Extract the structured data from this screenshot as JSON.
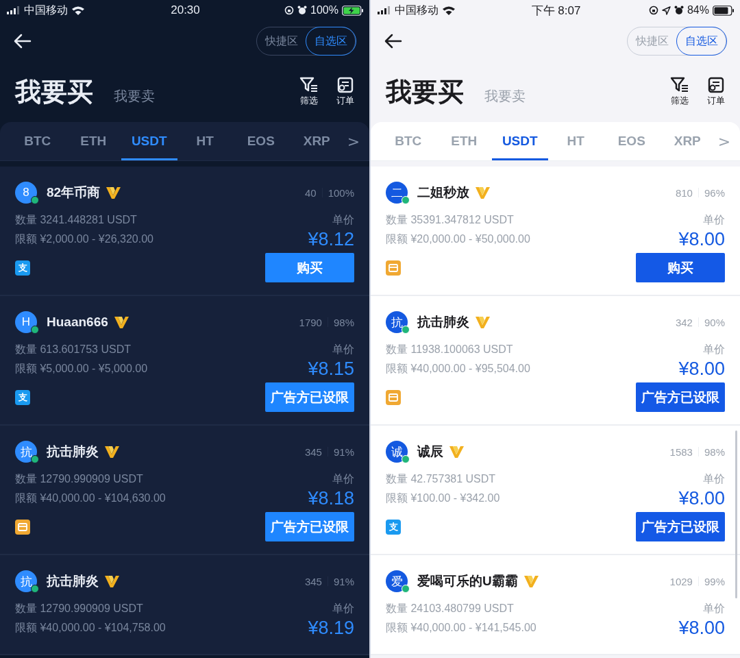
{
  "screens": [
    {
      "kind": "dark",
      "status_bar": {
        "carrier": "中国移动",
        "time": "20:30",
        "battery": "100%",
        "charging": true,
        "location": false
      },
      "segments": [
        {
          "label": "快捷区",
          "selected": false
        },
        {
          "label": "自选区",
          "selected": true
        }
      ],
      "modes": [
        {
          "label": "我要买",
          "selected": true
        },
        {
          "label": "我要卖",
          "selected": false
        }
      ],
      "actions": [
        {
          "kind": "filter",
          "label": "筛选"
        },
        {
          "kind": "orders",
          "label": "订单"
        }
      ],
      "coins": [
        {
          "label": "BTC",
          "selected": false
        },
        {
          "label": "ETH",
          "selected": false
        },
        {
          "label": "USDT",
          "selected": true
        },
        {
          "label": "HT",
          "selected": false
        },
        {
          "label": "EOS",
          "selected": false
        },
        {
          "label": "XRP",
          "selected": false
        }
      ],
      "more": ">",
      "offers": [
        {
          "avatar": "8",
          "online": true,
          "name": "82年币商",
          "trades": "40",
          "rate": "100%",
          "quantity": "数量 3241.448281 USDT",
          "limit": "限额 ¥2,000.00 - ¥26,320.00",
          "price_label": "单价",
          "price": "¥8.12",
          "payment": {
            "kind": "alipay",
            "glyph": "支"
          },
          "button": "购买"
        },
        {
          "avatar": "H",
          "online": true,
          "name": "Huaan666",
          "trades": "1790",
          "rate": "98%",
          "quantity": "数量 613.601753 USDT",
          "limit": "限额 ¥5,000.00 - ¥5,000.00",
          "price_label": "单价",
          "price": "¥8.15",
          "payment": {
            "kind": "alipay",
            "glyph": "支"
          },
          "button": "广告方已设限"
        },
        {
          "avatar": "抗",
          "online": true,
          "name": "抗击肺炎",
          "trades": "345",
          "rate": "91%",
          "quantity": "数量 12790.990909 USDT",
          "limit": "限额 ¥40,000.00 - ¥104,630.00",
          "price_label": "单价",
          "price": "¥8.18",
          "payment": {
            "kind": "card"
          },
          "button": "广告方已设限"
        },
        {
          "avatar": "抗",
          "online": true,
          "name": "抗击肺炎",
          "trades": "345",
          "rate": "91%",
          "quantity": "数量 12790.990909 USDT",
          "limit": "限额 ¥40,000.00 - ¥104,758.00",
          "price_label": "单价",
          "price": "¥8.19"
        }
      ]
    },
    {
      "kind": "light",
      "status_bar": {
        "carrier": "中国移动",
        "time": "下午 8:07",
        "battery": "84%",
        "charging": false,
        "location": true
      },
      "segments": [
        {
          "label": "快捷区",
          "selected": false
        },
        {
          "label": "自选区",
          "selected": true
        }
      ],
      "modes": [
        {
          "label": "我要买",
          "selected": true
        },
        {
          "label": "我要卖",
          "selected": false
        }
      ],
      "actions": [
        {
          "kind": "filter",
          "label": "筛选"
        },
        {
          "kind": "orders",
          "label": "订单"
        }
      ],
      "coins": [
        {
          "label": "BTC",
          "selected": false
        },
        {
          "label": "ETH",
          "selected": false
        },
        {
          "label": "USDT",
          "selected": true
        },
        {
          "label": "HT",
          "selected": false
        },
        {
          "label": "EOS",
          "selected": false
        },
        {
          "label": "XRP",
          "selected": false
        }
      ],
      "more": ">",
      "offers": [
        {
          "avatar": "二",
          "online": true,
          "name": "二姐秒放",
          "trades": "810",
          "rate": "96%",
          "quantity": "数量 35391.347812 USDT",
          "limit": "限额 ¥20,000.00 - ¥50,000.00",
          "price_label": "单价",
          "price": "¥8.00",
          "payment": {
            "kind": "card"
          },
          "button": "购买"
        },
        {
          "avatar": "抗",
          "online": true,
          "name": "抗击肺炎",
          "trades": "342",
          "rate": "90%",
          "quantity": "数量 11938.100063 USDT",
          "limit": "限额 ¥40,000.00 - ¥95,504.00",
          "price_label": "单价",
          "price": "¥8.00",
          "payment": {
            "kind": "card"
          },
          "button": "广告方已设限"
        },
        {
          "avatar": "诚",
          "online": true,
          "name": "诚辰",
          "trades": "1583",
          "rate": "98%",
          "quantity": "数量 42.757381 USDT",
          "limit": "限额 ¥100.00 - ¥342.00",
          "price_label": "单价",
          "price": "¥8.00",
          "payment": {
            "kind": "alipay",
            "glyph": "支"
          },
          "button": "广告方已设限"
        },
        {
          "avatar": "爱",
          "online": true,
          "name": "爱喝可乐的U霸霸",
          "trades": "1029",
          "rate": "99%",
          "quantity": "数量 24103.480799 USDT",
          "limit": "限额 ¥40,000.00 - ¥141,545.00",
          "price_label": "单价",
          "price": "¥8.00"
        }
      ]
    }
  ]
}
